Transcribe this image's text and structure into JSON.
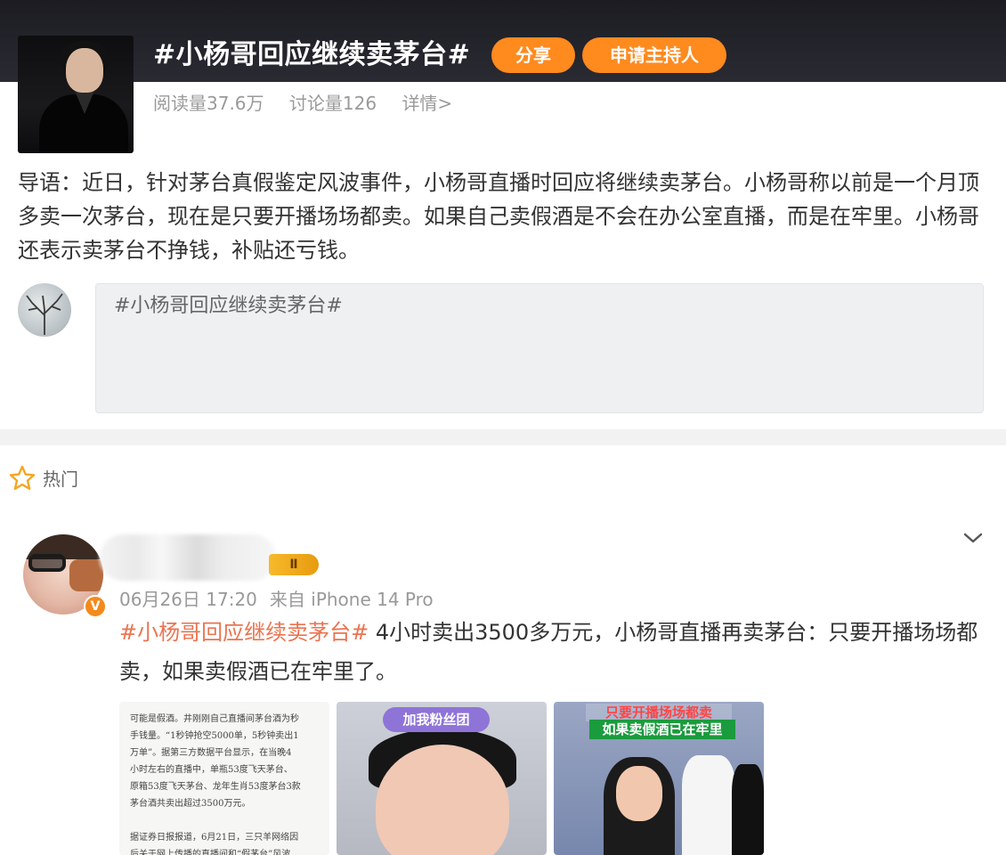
{
  "header": {
    "topic_title": "#小杨哥回应继续卖茅台#",
    "share_label": "分享",
    "host_label": "申请主持人",
    "reads": "阅读量37.6万",
    "discussions": "讨论量126",
    "details": "详情>"
  },
  "intro": {
    "text": "导语：近日，针对茅台真假鉴定风波事件，小杨哥直播时回应将继续卖茅台。小杨哥称以前是一个月顶多卖一次茅台，现在是只要开播场场都卖。如果自己卖假酒是不会在办公室直播，而是在牢里。小杨哥还表示卖茅台不挣钱，补贴还亏钱。"
  },
  "composer": {
    "text": "#小杨哥回应继续卖茅台#"
  },
  "section": {
    "hot_label": "热门"
  },
  "post": {
    "level_badge": "Ⅱ",
    "verified_mark": "V",
    "date": "06月26日 17:20",
    "source": "来自 iPhone 14 Pro",
    "hashtag": "#小杨哥回应继续卖茅台#",
    "body": " 4小时卖出3500多万元，小杨哥直播再卖茅台：只要开播场场都卖，如果卖假酒已在牢里了。",
    "image1_lines": [
      "可能是假酒。井刚刚自己直播间茅台酒为秒",
      "手钱量。“1秒钟抢空5000单，5秒钟卖出1",
      "万单”。据第三方数据平台显示，在当晚4",
      "小时左右的直播中，单瓶53度飞天茅台、",
      "原箱53度飞天茅台、龙年生肖53度茅台3款",
      "茅台酒共卖出超过3500万元。",
      "",
      "据证券日报报道，6月21日，三只羊网络因",
      "后关于网上传播的直播间和“假茅台”风波"
    ],
    "image2_sign": "加我粉丝团",
    "image3_caption_top": "只要开播场场都卖",
    "image3_caption": "如果卖假酒已在牢里"
  },
  "colors": {
    "accent_orange": "#ff8a1e",
    "hashtag": "#eb7350",
    "topbar": "#1c1c22"
  },
  "icons": {
    "star": "star-outline-icon",
    "chevron": "chevron-down-icon"
  }
}
